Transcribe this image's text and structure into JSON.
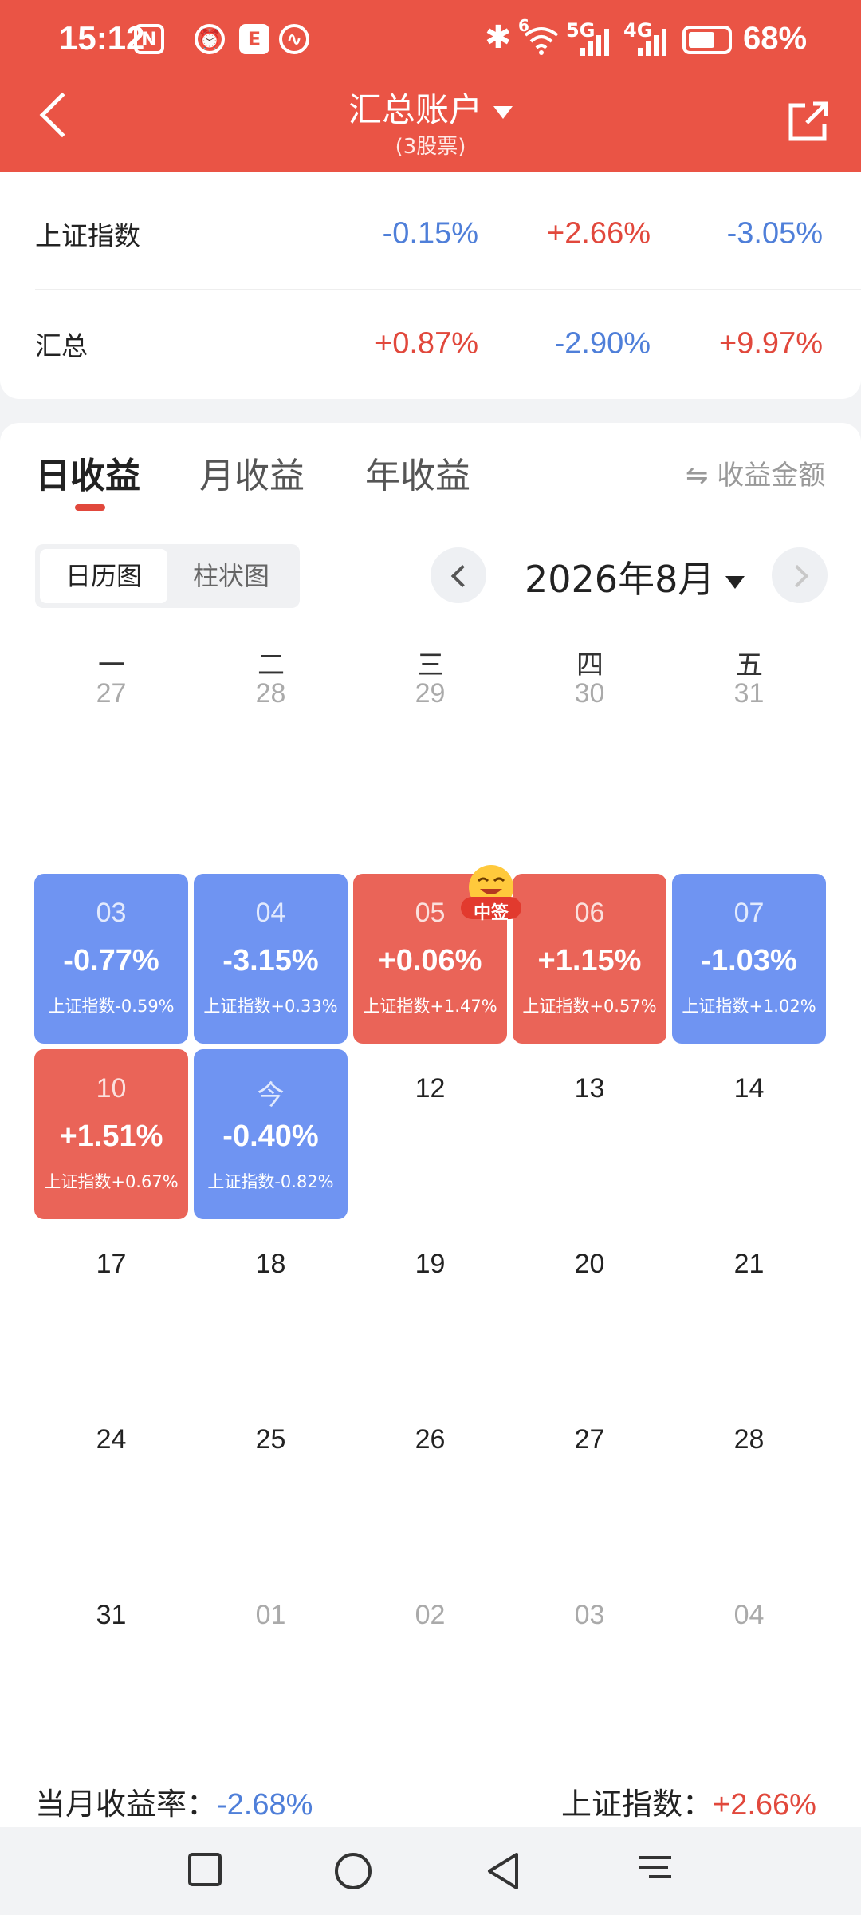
{
  "status_bar": {
    "time": "15:12",
    "battery": "68%",
    "network_1": "5G",
    "network_2": "4G",
    "wifi_sup": "6"
  },
  "header": {
    "title": "汇总账户",
    "subtitle": "(3股票)"
  },
  "index_rows": [
    {
      "label": "上证指数",
      "values": [
        "-0.15%",
        "+2.66%",
        "-3.05%"
      ],
      "signs": [
        "neg",
        "pos",
        "neg"
      ]
    },
    {
      "label": "汇总",
      "values": [
        "+0.87%",
        "-2.90%",
        "+9.97%"
      ],
      "signs": [
        "pos",
        "neg",
        "pos"
      ]
    }
  ],
  "tabs": [
    "日收益",
    "月收益",
    "年收益"
  ],
  "active_tab": "日收益",
  "switch_label": "⇋ 收益金额",
  "view_toggle": {
    "options": [
      "日历图",
      "柱状图"
    ],
    "selected": "日历图"
  },
  "month_label": "2026年8月",
  "weekdays": [
    "一",
    "二",
    "三",
    "四",
    "五"
  ],
  "calendar": [
    [
      {
        "day": "27",
        "faded": true
      },
      {
        "day": "28",
        "faded": true
      },
      {
        "day": "29",
        "faded": true
      },
      {
        "day": "30",
        "faded": true
      },
      {
        "day": "31",
        "faded": true
      }
    ],
    [
      {
        "day": "03",
        "pct": "-0.77%",
        "idx": "上证指数-0.59%",
        "color": "blue"
      },
      {
        "day": "04",
        "pct": "-3.15%",
        "idx": "上证指数+0.33%",
        "color": "blue"
      },
      {
        "day": "05",
        "pct": "+0.06%",
        "idx": "上证指数+1.47%",
        "color": "red"
      },
      {
        "day": "06",
        "pct": "+1.15%",
        "idx": "上证指数+0.57%",
        "color": "red"
      },
      {
        "day": "07",
        "pct": "-1.03%",
        "idx": "上证指数+1.02%",
        "color": "blue"
      }
    ],
    [
      {
        "day": "10",
        "pct": "+1.51%",
        "idx": "上证指数+0.67%",
        "color": "red"
      },
      {
        "day": "今",
        "pct": "-0.40%",
        "idx": "上证指数-0.82%",
        "color": "blue"
      },
      {
        "day": "12"
      },
      {
        "day": "13"
      },
      {
        "day": "14"
      }
    ],
    [
      {
        "day": "17"
      },
      {
        "day": "18"
      },
      {
        "day": "19"
      },
      {
        "day": "20"
      },
      {
        "day": "21"
      }
    ],
    [
      {
        "day": "24"
      },
      {
        "day": "25"
      },
      {
        "day": "26"
      },
      {
        "day": "27"
      },
      {
        "day": "28"
      }
    ],
    [
      {
        "day": "31"
      },
      {
        "day": "01",
        "faded": true
      },
      {
        "day": "02",
        "faded": true
      },
      {
        "day": "03",
        "faded": true
      },
      {
        "day": "04",
        "faded": true
      }
    ]
  ],
  "lottery_badge": "中签",
  "summary": {
    "month_label": "当月收益率：",
    "month_value": "-2.68%",
    "index_label": "上证指数：",
    "index_value": "+2.66%"
  },
  "colors": {
    "header": "#ea5445",
    "up": "#e1483c",
    "down": "#4f7fd9",
    "cell_up": "#ea6458",
    "cell_down": "#6f94f2"
  }
}
